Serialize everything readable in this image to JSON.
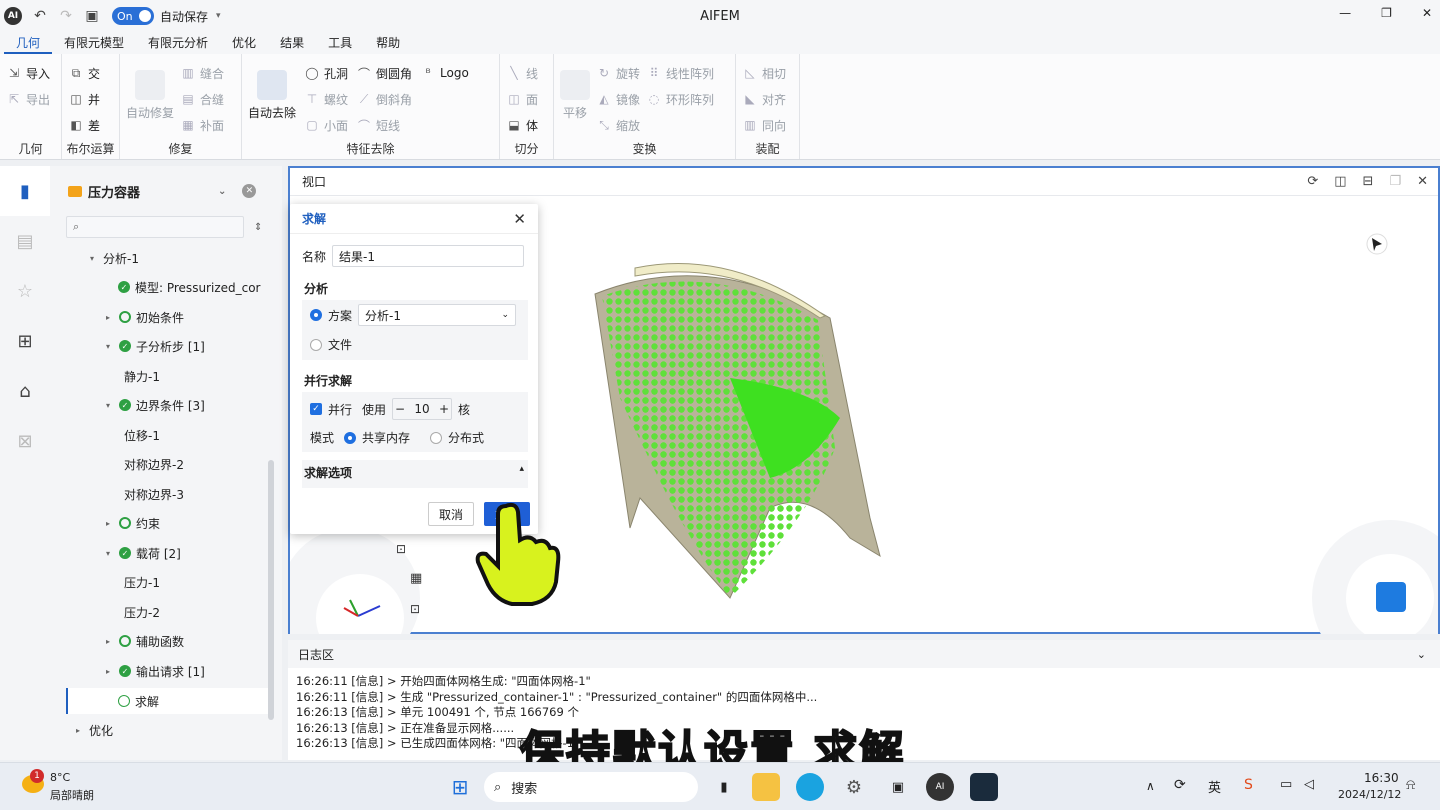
{
  "titlebar": {
    "toggle": "On",
    "autosave": "自动保存",
    "app_title": "AIFEM"
  },
  "menus": [
    "几何",
    "有限元模型",
    "有限元分析",
    "优化",
    "结果",
    "工具",
    "帮助"
  ],
  "ribbon": {
    "geometry": {
      "label": "几何",
      "import": "导入",
      "export": "导出"
    },
    "boolean": {
      "label": "布尔运算",
      "intersect": "交",
      "union": "并",
      "subtract": "差"
    },
    "repair": {
      "label": "修复",
      "auto_repair": "自动修复",
      "sew": "缝合",
      "merge": "合缝",
      "patch": "补面"
    },
    "feature": {
      "label": "特征去除",
      "auto_remove": "自动去除",
      "hole": "孔洞",
      "thread": "螺纹",
      "small_face": "小面",
      "fillet": "倒圆角",
      "chamfer": "倒斜角",
      "short_edge": "短线",
      "logo": "Logo"
    },
    "cut": {
      "label": "切分",
      "line": "线",
      "face": "面",
      "body": "体"
    },
    "transform": {
      "label": "变换",
      "translate": "平移",
      "rotate": "旋转",
      "mirror": "镜像",
      "scale": "缩放",
      "linear_array": "线性阵列",
      "circular_array": "环形阵列"
    },
    "assembly": {
      "label": "装配",
      "tangent": "相切",
      "align": "对齐",
      "same_dir": "同向"
    }
  },
  "tree": {
    "title": "压力容器",
    "nodes": [
      {
        "label": "分析-1"
      },
      {
        "label": "模型:  Pressurized_cor"
      },
      {
        "label": "初始条件"
      },
      {
        "label": "子分析步  [1]"
      },
      {
        "label": "静力-1"
      },
      {
        "label": "边界条件  [3]"
      },
      {
        "label": "位移-1"
      },
      {
        "label": "对称边界-2"
      },
      {
        "label": "对称边界-3"
      },
      {
        "label": "约束"
      },
      {
        "label": "载荷  [2]"
      },
      {
        "label": "压力-1"
      },
      {
        "label": "压力-2"
      },
      {
        "label": "辅助函数"
      },
      {
        "label": "输出请求  [1]"
      },
      {
        "label": "求解"
      },
      {
        "label": "优化"
      }
    ]
  },
  "viewport": {
    "title": "视口"
  },
  "dialog": {
    "title": "求解",
    "name_label": "名称",
    "name_value": "结果-1",
    "analysis_label": "分析",
    "scheme_label": "方案",
    "scheme_value": "分析-1",
    "file_label": "文件",
    "parallel_title": "并行求解",
    "parallel_label": "并行",
    "use_label": "使用",
    "cores_value": "10",
    "cores_unit": "核",
    "mode_label": "模式",
    "shared_mem": "共享内存",
    "distributed": "分布式",
    "options_label": "求解选项",
    "cancel": "取消",
    "solve": "求解"
  },
  "log": {
    "title": "日志区",
    "lines": [
      "16:26:11 [信息] > 开始四面体网格生成: \"四面体网格-1\"",
      "16:26:11 [信息] > 生成 \"Pressurized_container-1\" : \"Pressurized_container\" 的四面体网格中...",
      "16:26:13 [信息] > 单元 100491 个, 节点 166769 个",
      "16:26:13 [信息] > 正在准备显示网格......",
      "16:26:13 [信息] > 已生成四面体网格: \"四面体网格-1\""
    ]
  },
  "subtitle": "保持默认设置 求解",
  "taskbar": {
    "temp": "8°C",
    "weather": "局部晴朗",
    "badge": "1",
    "search": "搜索",
    "time": "16:30",
    "date": "2024/12/12",
    "ime": "英"
  }
}
